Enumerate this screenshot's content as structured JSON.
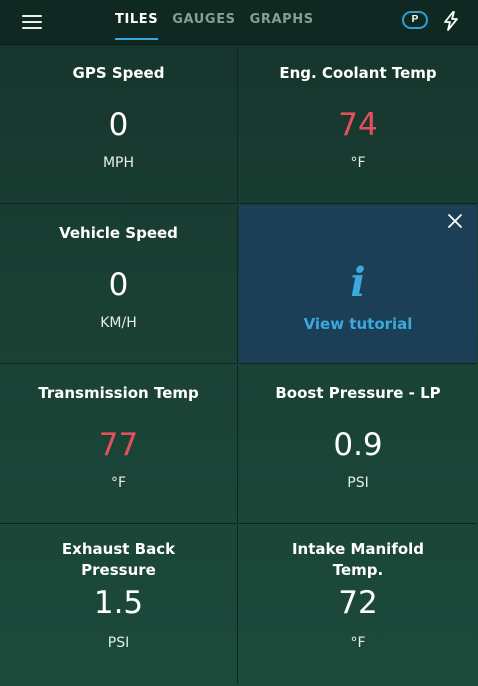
{
  "topbar": {
    "menu_icon": "hamburger-menu-icon",
    "tabs": [
      {
        "label": "TILES",
        "active": true
      },
      {
        "label": "GAUGES",
        "active": false
      },
      {
        "label": "GRAPHS",
        "active": false
      }
    ],
    "badge_label": "P",
    "badge_color": "#2e9fd4",
    "right_icon": "lightning-bolt-icon"
  },
  "colors": {
    "alert_value": "#e5505f",
    "accent": "#3aa9dc",
    "tile_bg": "#1a4034",
    "tutorial_bg": "#1c3f57"
  },
  "tiles": [
    {
      "title": "GPS Speed",
      "value": "0",
      "unit": "MPH",
      "alert": false
    },
    {
      "title": "Eng. Coolant Temp",
      "value": "74",
      "unit": "°F",
      "alert": true
    },
    {
      "title": "Vehicle Speed",
      "value": "0",
      "unit": "KM/H",
      "alert": false
    },
    {
      "title": "Transmission Temp",
      "value": "77",
      "unit": "°F",
      "alert": true
    },
    {
      "title": "Boost Pressure - LP",
      "value": "0.9",
      "unit": "PSI",
      "alert": false
    },
    {
      "title": "Exhaust Back\nPressure",
      "value": "1.5",
      "unit": "PSI",
      "alert": false
    },
    {
      "title": "Intake Manifold\nTemp.",
      "value": "72",
      "unit": "°F",
      "alert": false
    }
  ],
  "tutorial": {
    "icon": "info-icon",
    "icon_glyph": "i",
    "link_label": "View tutorial",
    "close_icon": "close-icon"
  }
}
